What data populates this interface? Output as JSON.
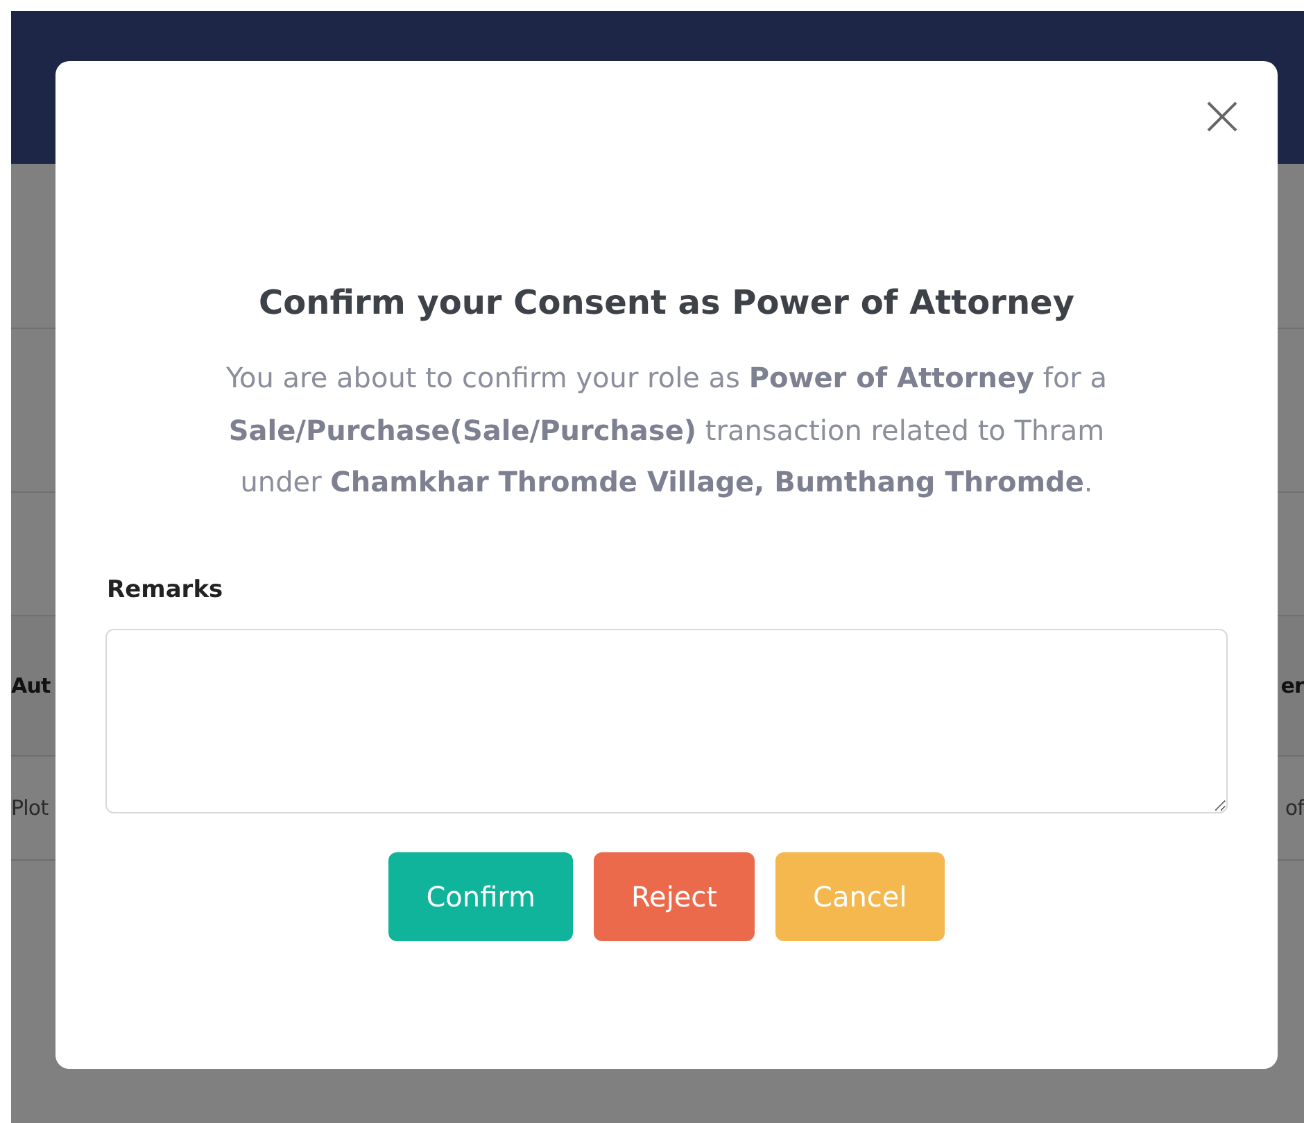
{
  "background_table": {
    "columns": [
      "Aut",
      "er"
    ],
    "rows": [
      [
        "Plot",
        "of"
      ]
    ]
  },
  "dialog": {
    "title": "Confirm your Consent as Power of Attorney",
    "message": "You are about to confirm your role as **Power of Attorney** for a **Sale/Purchase(Sale/Purchase)** transaction related to Thram under **Chamkhar Thromde Village, Bumthang Thromde**.",
    "remarks": {
      "label": "Remarks"
    },
    "buttons": [
      {
        "label": "Confirm",
        "kind": "confirm"
      },
      {
        "label": "Reject",
        "kind": "reject"
      },
      {
        "label": "Cancel",
        "kind": "cancel"
      }
    ]
  }
}
